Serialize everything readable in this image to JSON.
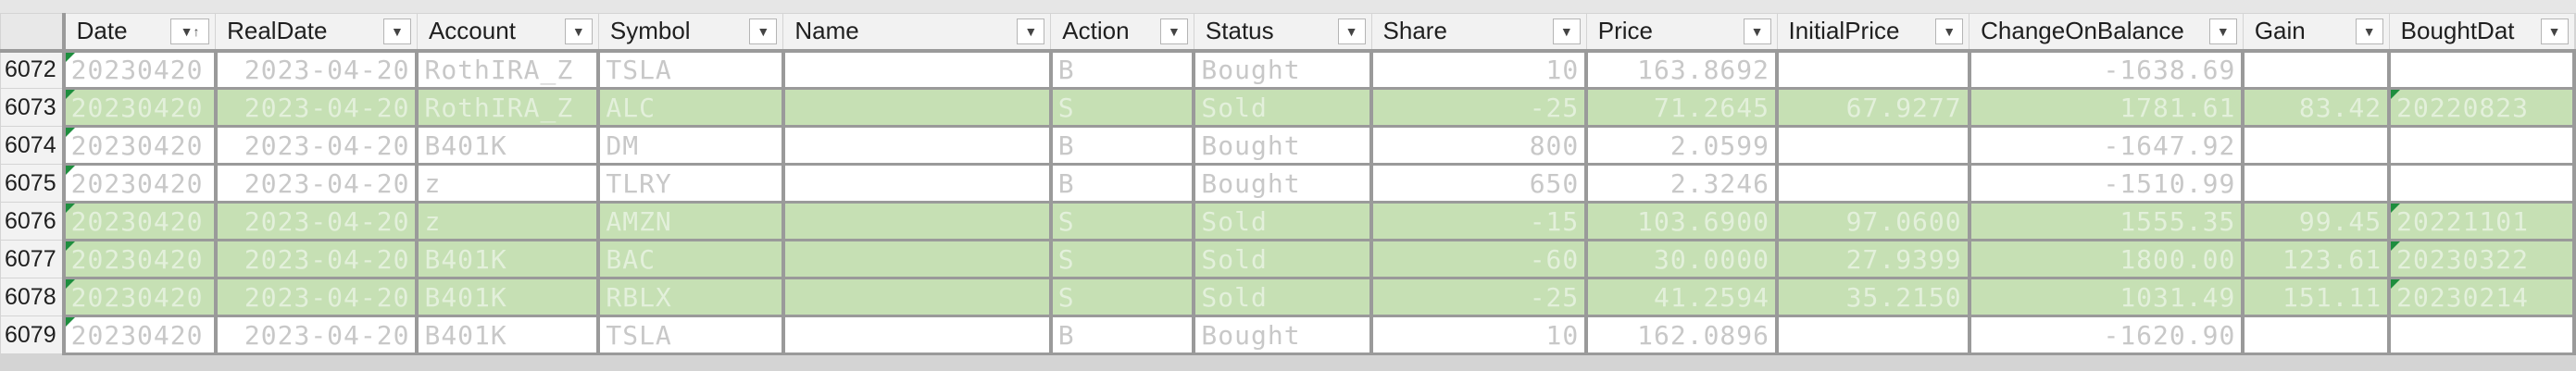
{
  "columns": [
    "Date",
    "RealDate",
    "Account",
    "Symbol",
    "Name",
    "Action",
    "Status",
    "Share",
    "Price",
    "InitialPrice",
    "ChangeOnBalance",
    "Gain",
    "BoughtDat"
  ],
  "rows": [
    {
      "n": "6072",
      "type": "plain",
      "cells": [
        "20230420",
        "2023-04-20",
        "RothIRA_Z",
        "TSLA",
        "",
        "B",
        "Bought",
        "10",
        "163.8692",
        "",
        "-1638.69",
        "",
        ""
      ]
    },
    {
      "n": "6073",
      "type": "sold",
      "cells": [
        "20230420",
        "2023-04-20",
        "RothIRA_Z",
        "ALC",
        "",
        "S",
        "Sold",
        "-25",
        "71.2645",
        "67.9277",
        "1781.61",
        "83.42",
        "20220823"
      ]
    },
    {
      "n": "6074",
      "type": "plain",
      "cells": [
        "20230420",
        "2023-04-20",
        "B401K",
        "DM",
        "",
        "B",
        "Bought",
        "800",
        "2.0599",
        "",
        "-1647.92",
        "",
        ""
      ]
    },
    {
      "n": "6075",
      "type": "plain",
      "cells": [
        "20230420",
        "2023-04-20",
        "z",
        "TLRY",
        "",
        "B",
        "Bought",
        "650",
        "2.3246",
        "",
        "-1510.99",
        "",
        ""
      ]
    },
    {
      "n": "6076",
      "type": "sold",
      "cells": [
        "20230420",
        "2023-04-20",
        "z",
        "AMZN",
        "",
        "S",
        "Sold",
        "-15",
        "103.6900",
        "97.0600",
        "1555.35",
        "99.45",
        "20221101"
      ]
    },
    {
      "n": "6077",
      "type": "sold",
      "cells": [
        "20230420",
        "2023-04-20",
        "B401K",
        "BAC",
        "",
        "S",
        "Sold",
        "-60",
        "30.0000",
        "27.9399",
        "1800.00",
        "123.61",
        "20230322"
      ]
    },
    {
      "n": "6078",
      "type": "sold",
      "cells": [
        "20230420",
        "2023-04-20",
        "B401K",
        "RBLX",
        "",
        "S",
        "Sold",
        "-25",
        "41.2594",
        "35.2150",
        "1031.49",
        "151.11",
        "20230214"
      ]
    },
    {
      "n": "6079",
      "type": "plain",
      "cells": [
        "20230420",
        "2023-04-20",
        "B401K",
        "TSLA",
        "",
        "B",
        "Bought",
        "10",
        "162.0896",
        "",
        "-1620.90",
        "",
        ""
      ]
    }
  ]
}
